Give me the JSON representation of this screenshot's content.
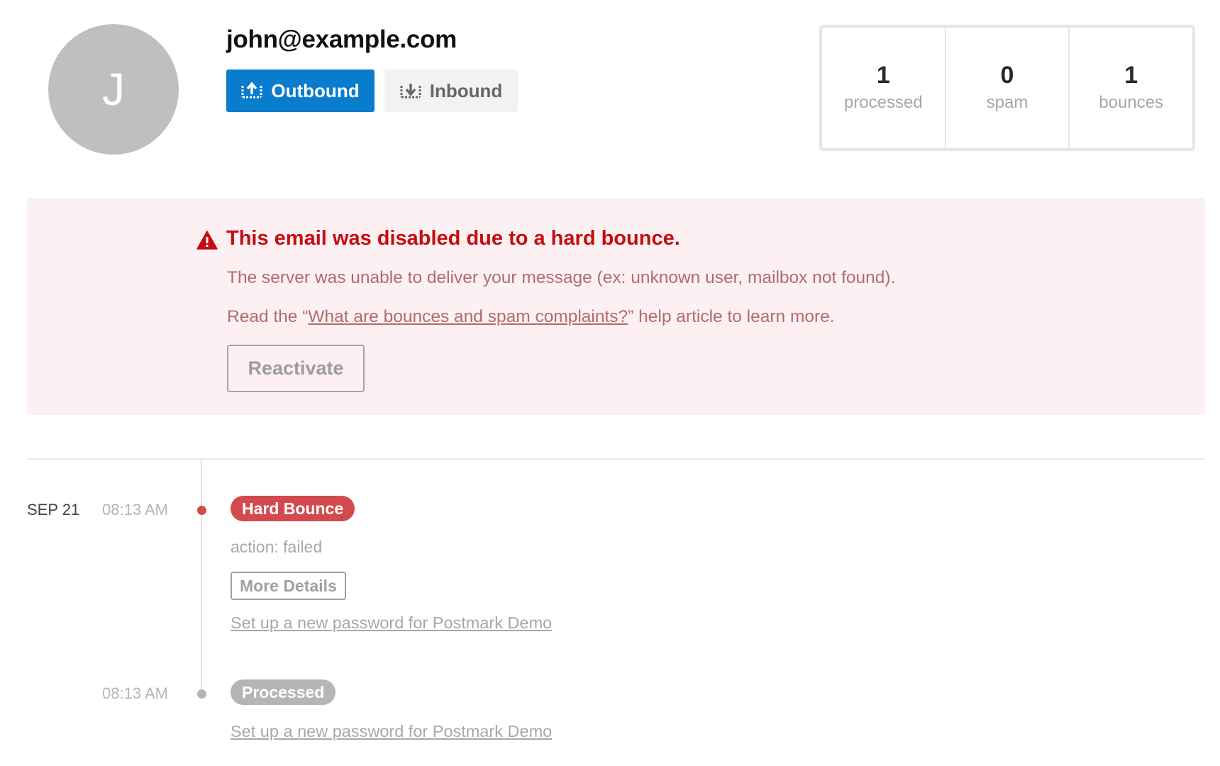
{
  "profile": {
    "avatar_initial": "J",
    "email": "john@example.com"
  },
  "direction_tabs": [
    {
      "label": "Outbound",
      "icon": "outbound-icon",
      "active": true
    },
    {
      "label": "Inbound",
      "icon": "inbound-icon",
      "active": false
    }
  ],
  "stats": [
    {
      "value": "1",
      "label": "processed"
    },
    {
      "value": "0",
      "label": "spam"
    },
    {
      "value": "1",
      "label": "bounces"
    }
  ],
  "alert": {
    "icon": "warning-icon",
    "title": "This email was disabled due to a hard bounce.",
    "description": "The server was unable to deliver your message (ex: unknown user, mailbox not found).",
    "help_prefix": "Read the “",
    "help_link": "What are bounces and spam complaints?",
    "help_suffix": "” help article to learn more.",
    "reactivate_label": "Reactivate"
  },
  "timeline": [
    {
      "date": "SEP 21",
      "time": "08:13 AM",
      "status": "Hard Bounce",
      "status_color": "#d24a4e",
      "meta": "action: failed",
      "details_label": "More Details",
      "message_subject": "Set up a new password for Postmark Demo"
    },
    {
      "date": "",
      "time": "08:13 AM",
      "status": "Processed",
      "status_color": "#b5b5b5",
      "message_subject": "Set up a new password for Postmark Demo"
    }
  ],
  "colors": {
    "accent": "#0a7ccd",
    "danger": "#c40d12",
    "alert_bg": "#fcf0f2"
  }
}
